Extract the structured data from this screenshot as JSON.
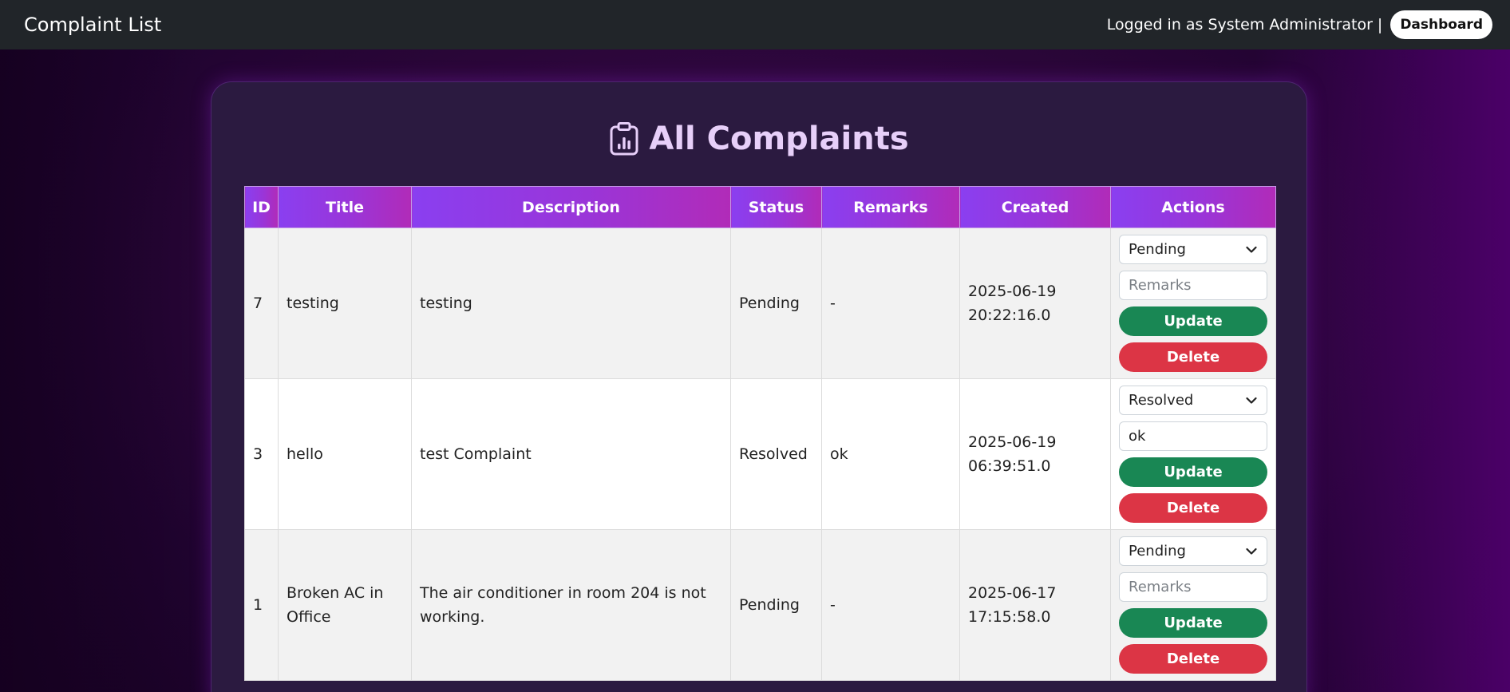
{
  "navbar": {
    "brand": "Complaint List",
    "logged_in_text": "Logged in as System Administrator",
    "separator": "|",
    "dashboard_label": "Dashboard"
  },
  "page": {
    "heading": "All Complaints",
    "heading_icon": "clipboard-chart-icon"
  },
  "table": {
    "headers": [
      "ID",
      "Title",
      "Description",
      "Status",
      "Remarks",
      "Created",
      "Actions"
    ],
    "rows": [
      {
        "id": "7",
        "title": "testing",
        "description": "testing",
        "status": "Pending",
        "remarks": "-",
        "created_date": "2025-06-19",
        "created_time": "20:22:16.0",
        "select_value": "Pending",
        "remarks_input_value": "",
        "remarks_placeholder": "Remarks",
        "update_label": "Update",
        "delete_label": "Delete"
      },
      {
        "id": "3",
        "title": "hello",
        "description": "test Complaint",
        "status": "Resolved",
        "remarks": "ok",
        "created_date": "2025-06-19",
        "created_time": "06:39:51.0",
        "select_value": "Resolved",
        "remarks_input_value": "ok",
        "remarks_placeholder": "Remarks",
        "update_label": "Update",
        "delete_label": "Delete"
      },
      {
        "id": "1",
        "title": "Broken AC in Office",
        "description": "The air conditioner in room 204 is not working.",
        "status": "Pending",
        "remarks": "-",
        "created_date": "2025-06-17",
        "created_time": "17:15:58.0",
        "select_value": "Pending",
        "remarks_input_value": "",
        "remarks_placeholder": "Remarks",
        "update_label": "Update",
        "delete_label": "Delete"
      }
    ]
  },
  "colors": {
    "navbar_bg": "#212529",
    "header_gradient_start": "#8a3ff0",
    "header_gradient_end": "#b12bb8",
    "update_button": "#198754",
    "delete_button": "#dc3545",
    "heading_text": "#e7cff9"
  }
}
